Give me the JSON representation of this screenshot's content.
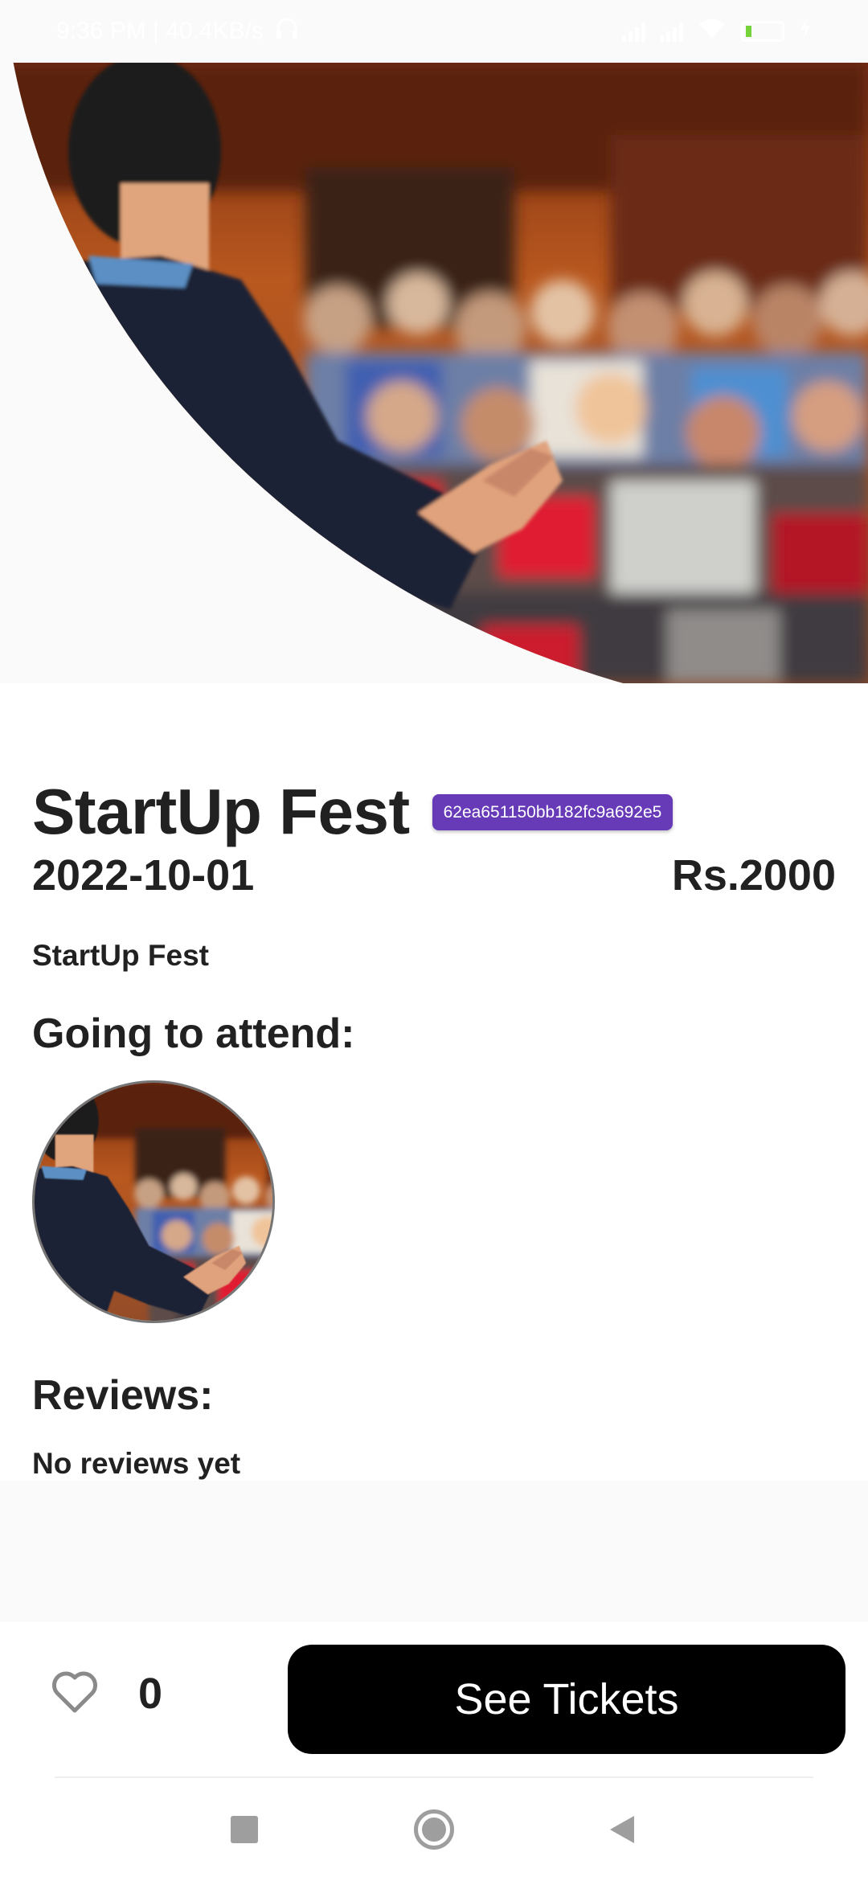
{
  "status_bar": {
    "time_speed": "9:36 PM | 40.4KB/s",
    "battery_level": "20"
  },
  "event": {
    "title": "StartUp Fest",
    "id": "62ea651150bb182fc9a692e5",
    "date": "2022-10-01",
    "price": "Rs.2000",
    "description": "StartUp Fest"
  },
  "attendees": {
    "heading": "Going to attend:"
  },
  "reviews": {
    "heading": "Reviews:",
    "empty_text": "No reviews yet"
  },
  "actions": {
    "like_count": "0",
    "tickets_label": "See Tickets"
  },
  "icons": {
    "like": "heart-outline-icon",
    "nav_recents": "square-icon",
    "nav_home": "circle-icon",
    "nav_back": "triangle-back-icon"
  },
  "colors": {
    "badge": "#673ab7",
    "button": "#000000",
    "text": "#212121"
  }
}
